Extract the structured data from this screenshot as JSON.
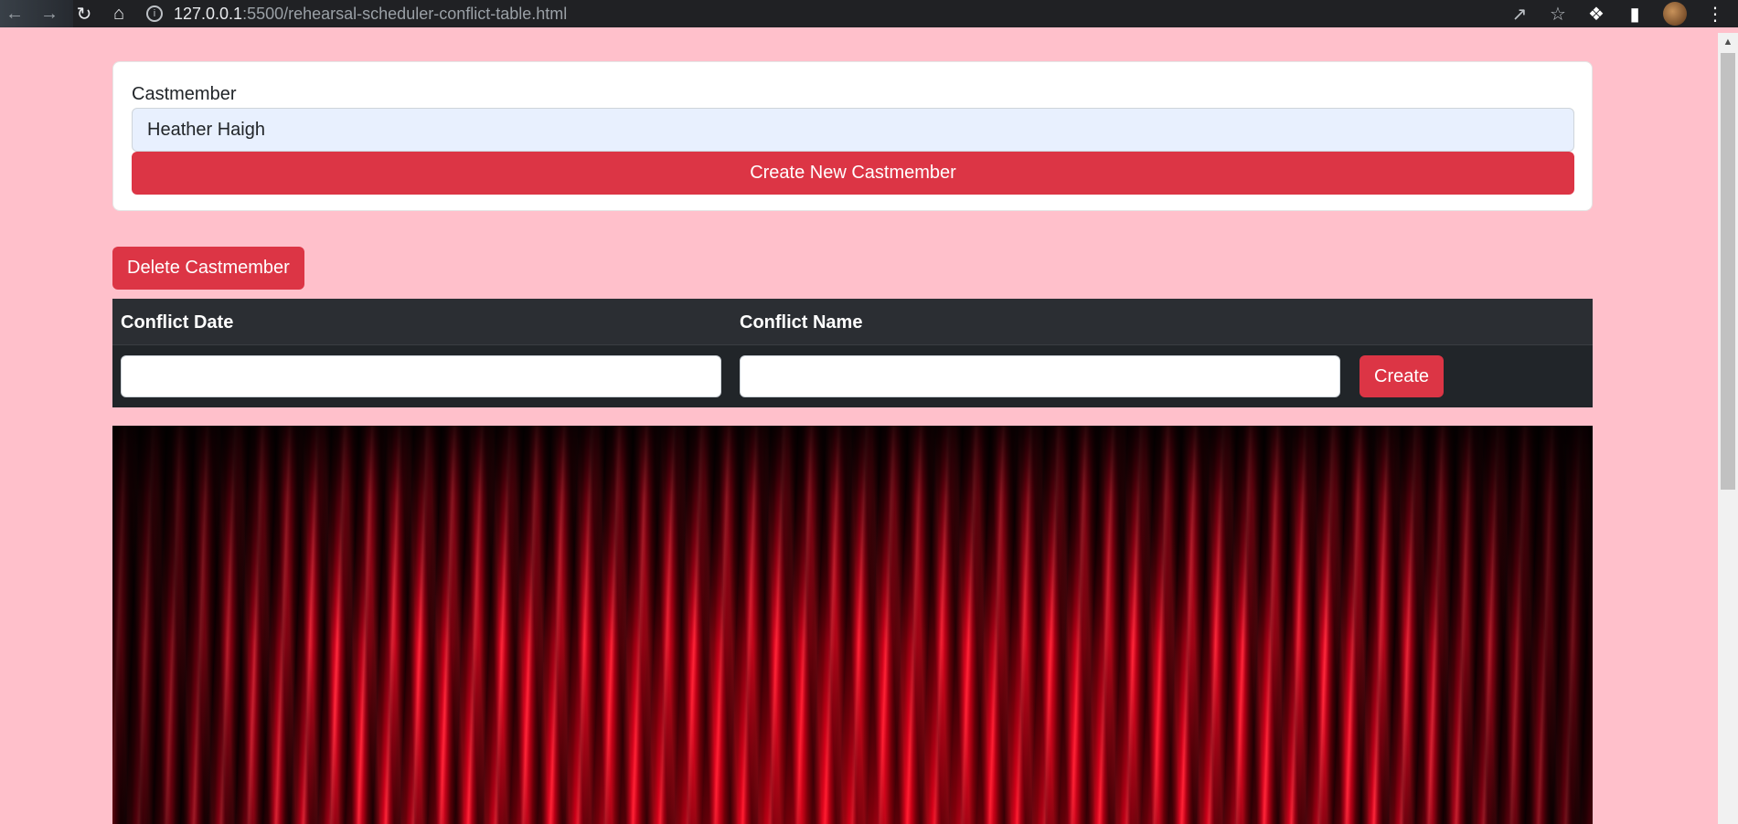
{
  "browser": {
    "url_host": "127.0.0.1",
    "url_path": ":5500/rehearsal-scheduler-conflict-table.html"
  },
  "form": {
    "label": "Castmember",
    "castmember_value": "Heather Haigh",
    "create_button": "Create New Castmember"
  },
  "delete_button": "Delete Castmember",
  "table": {
    "headers": [
      "Conflict Date",
      "Conflict Name"
    ],
    "new_row": {
      "date_value": "",
      "name_value": "",
      "create_button": "Create"
    }
  },
  "colors": {
    "background": "#ffc0cb",
    "accent": "#dc3545",
    "table_dark": "#212529"
  },
  "icons": [
    "back-icon",
    "forward-icon",
    "reload-icon",
    "home-icon",
    "info-icon",
    "share-icon",
    "star-icon",
    "extensions-icon",
    "sidebar-icon",
    "menu-icon"
  ]
}
